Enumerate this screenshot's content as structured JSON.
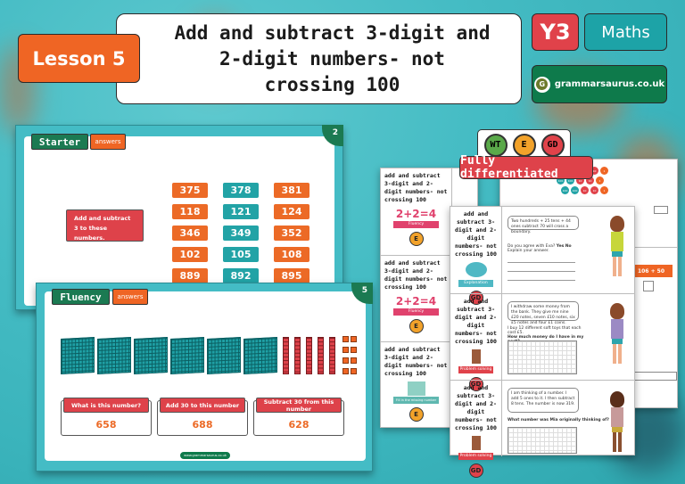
{
  "header": {
    "lesson": "Lesson 5",
    "title_lines": [
      "Add and subtract 3-digit and",
      "2-digit numbers- not",
      "crossing 100"
    ],
    "year": "Y3",
    "subject": "Maths",
    "brand": "grammarsaurus.co.uk",
    "brand_logo_letter": "G"
  },
  "slide_starter": {
    "number": "2",
    "title": "Starter",
    "answers_label": "answers",
    "instruction": "Add and subtract 3 to these numbers.",
    "grid": [
      [
        "375",
        "378",
        "381"
      ],
      [
        "118",
        "121",
        "124"
      ],
      [
        "346",
        "349",
        "352"
      ],
      [
        "102",
        "105",
        "108"
      ],
      [
        "889",
        "892",
        "895"
      ]
    ]
  },
  "slide_fluency": {
    "number": "5",
    "title": "Fluency",
    "answers_label": "answers",
    "base10": {
      "hundreds": 6,
      "tens": 5,
      "ones": 8
    },
    "cards": [
      {
        "label": "What is this number?",
        "value": "658"
      },
      {
        "label": "Add 30 to this number",
        "value": "688"
      },
      {
        "label": "Subtract 30 from this number",
        "value": "628"
      }
    ],
    "footer": "www.grammarsaurus.co.uk"
  },
  "differentiation": {
    "badges": [
      "WT",
      "E",
      "GD"
    ],
    "colors": [
      "#5aa94a",
      "#f2a22a",
      "#e0424a"
    ],
    "banner": "Fully differentiated"
  },
  "worksheets": {
    "title": "add and subtract 3-digit and 2-digit numbers- not crossing 100",
    "equation": "2+2=4",
    "skills": [
      "Fluency",
      "Explanation",
      "Problem solving",
      "Fill in the missing number"
    ],
    "levels": [
      "E",
      "GD"
    ],
    "q_eva": "Two hundreds + 25 tens + 44 ones subtract 70 will cross a boundary.",
    "q_eva_prompt": "Do you agree with Eva?",
    "yes": "Yes",
    "no": "No",
    "explain": "Explain your answer.",
    "q_bank": "I withdraw some money from the bank. They give me nine £20 notes, seven £10 notes, six £5 notes and four £1 coins.",
    "q_toys": "I buy 12 different soft toys that each cost £5.",
    "q_money": "How much money do I have in my nest?",
    "q_mia": "I am thinking of a number. I add 5 ones to it. I then subtract 8 tens. The number is now 319.",
    "q_mia_prompt": "What number was Mia originally thinking of?",
    "sum_label": "106 + 50",
    "circles": [
      "100",
      "100",
      "10",
      "10",
      "1"
    ]
  }
}
